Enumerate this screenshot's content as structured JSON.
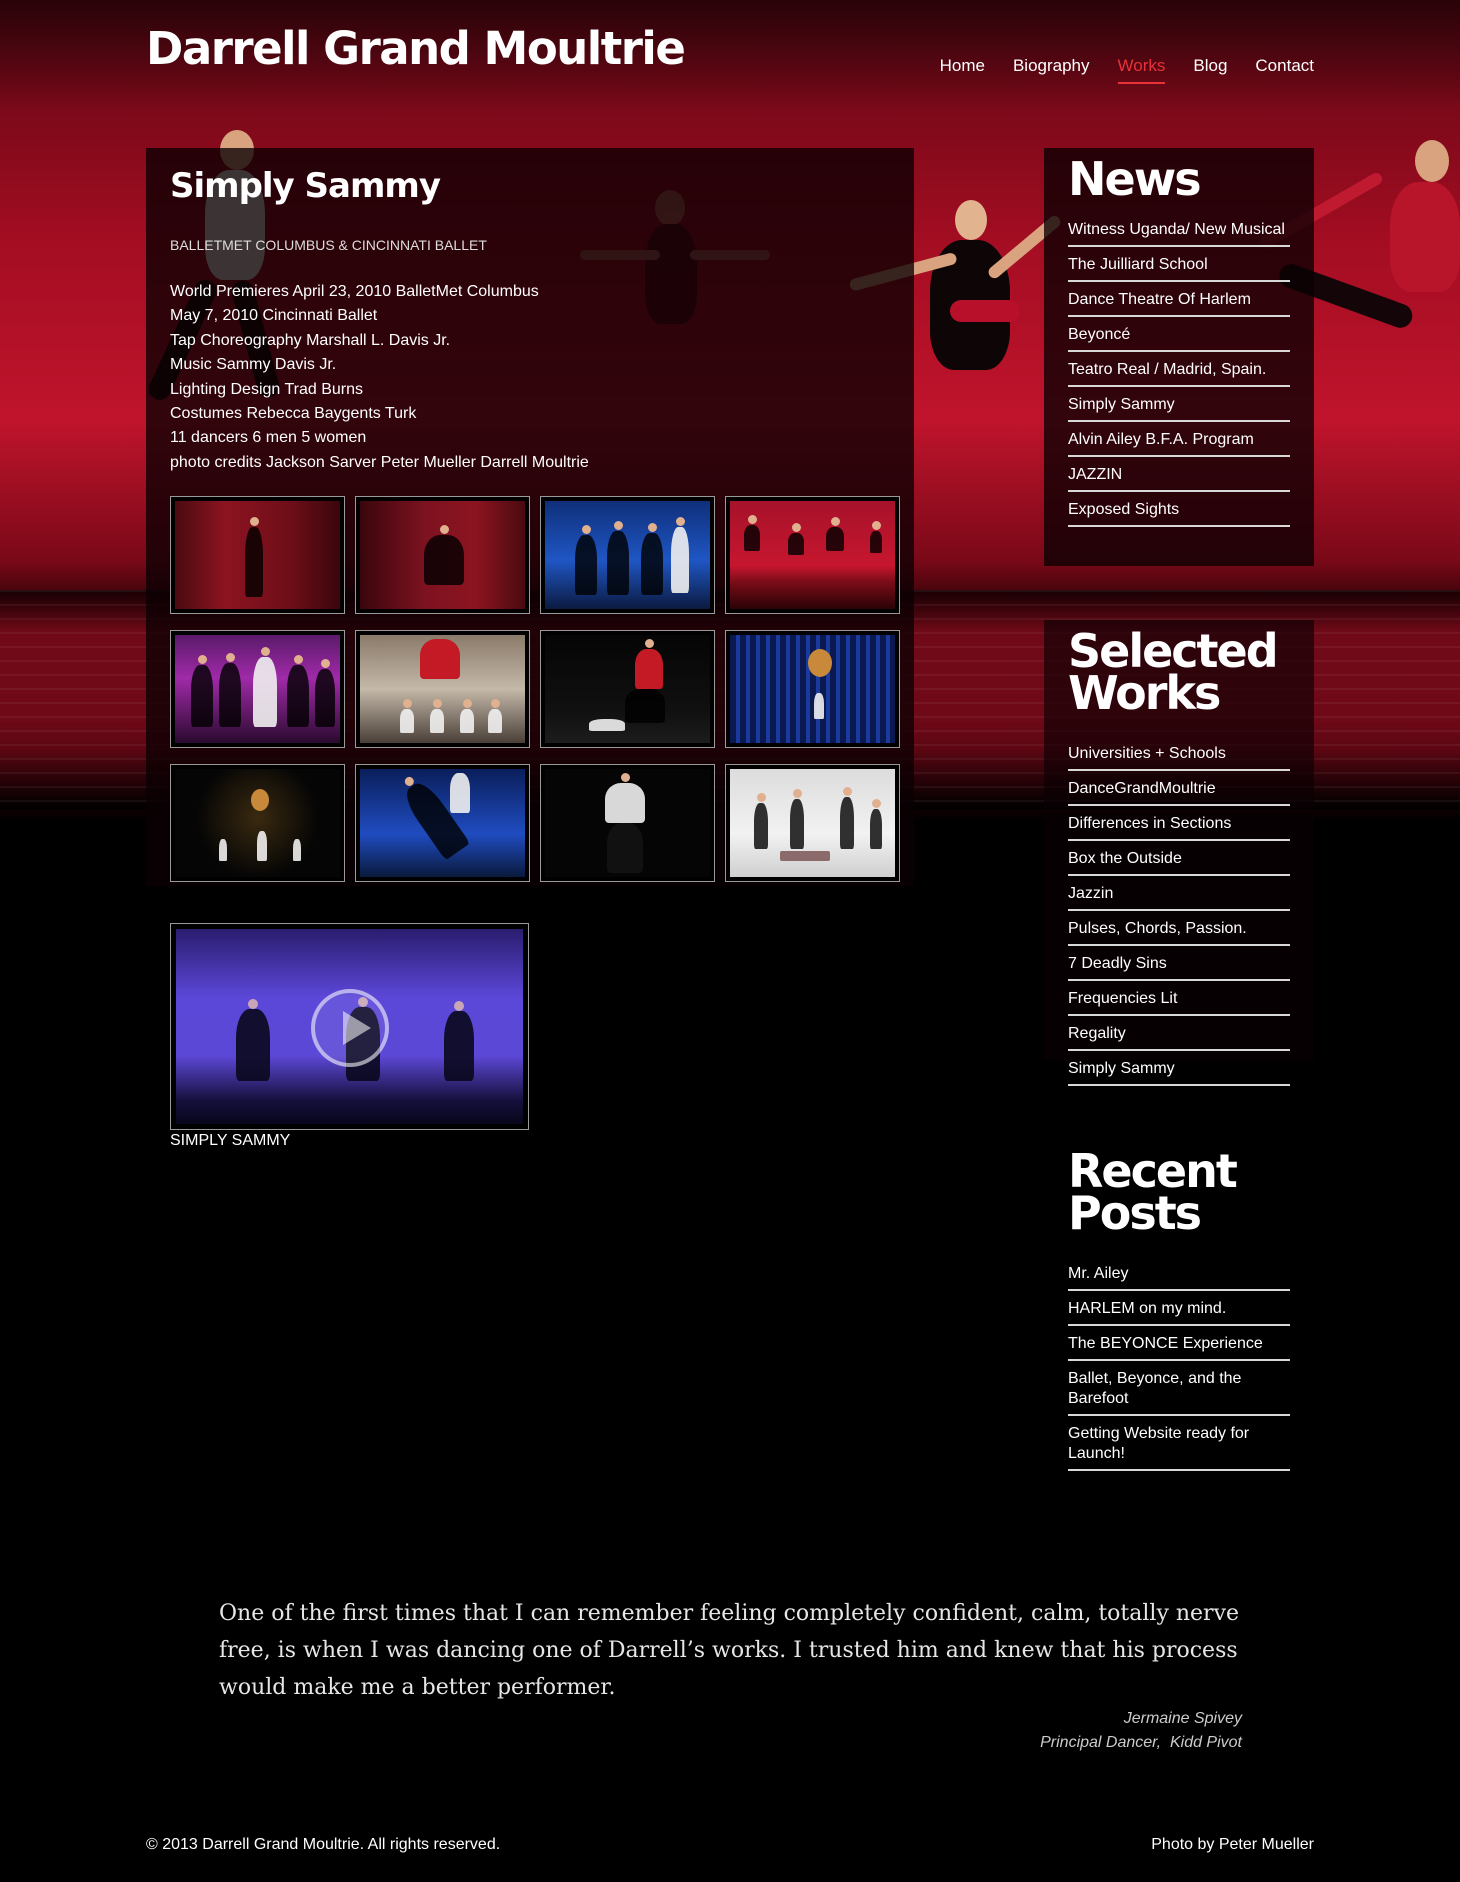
{
  "site": {
    "title": "Darrell Grand Moultrie"
  },
  "nav": [
    {
      "label": "Home",
      "active": false
    },
    {
      "label": "Biography",
      "active": false
    },
    {
      "label": "Works",
      "active": true
    },
    {
      "label": "Blog",
      "active": false
    },
    {
      "label": "Contact",
      "active": false
    }
  ],
  "work": {
    "title": "Simply Sammy",
    "subtitle": "BALLETMET COLUMBUS & CINCINNATI BALLET",
    "details": [
      "World Premieres April 23, 2010 BalletMet Columbus",
      "May 7, 2010 Cincinnati Ballet",
      "Tap Choreography Marshall L. Davis Jr.",
      "Music Sammy Davis Jr.",
      "Lighting Design Trad Burns",
      "Costumes Rebecca Baygents Turk",
      "11 dancers 6 men 5 women",
      "photo credits Jackson Sarver Peter Mueller Darrell Moultrie"
    ],
    "gallery_count": 12,
    "video_caption": "SIMPLY SAMMY"
  },
  "news": {
    "title": "News",
    "items": [
      "Witness Uganda/ New Musical",
      "The Juilliard School",
      "Dance Theatre Of Harlem",
      "Beyoncé",
      "Teatro Real / Madrid, Spain.",
      "Simply Sammy",
      "Alvin Ailey B.F.A. Program",
      "JAZZIN",
      "Exposed Sights"
    ]
  },
  "selected_works": {
    "title_line1": "Selected",
    "title_line2": "Works",
    "items": [
      "Universities + Schools",
      "DanceGrandMoultrie",
      "Differences in Sections",
      "Box the Outside",
      "Jazzin",
      "Pulses, Chords, Passion.",
      "7 Deadly Sins",
      "Frequencies Lit",
      "Regality",
      "Simply Sammy"
    ]
  },
  "recent_posts": {
    "title_line1": "Recent",
    "title_line2": "Posts",
    "items": [
      "Mr. Ailey",
      "HARLEM on my mind.",
      "The BEYONCE Experience",
      "Ballet, Beyonce, and the Barefoot",
      "Getting Website ready for Launch!"
    ]
  },
  "testimonial": {
    "text": "One of the first times that I can remember feeling completely confident, calm, totally nerve free, is when I was dancing one of Darrell’s works. I trusted him and knew that his process would make me a better performer.",
    "author": "Jermaine Spivey",
    "role": "Principal Dancer,  Kidd Pivot"
  },
  "footer": {
    "copyright": "© 2013 Darrell Grand Moultrie. All rights reserved.",
    "credit": "Photo by Peter Mueller"
  }
}
